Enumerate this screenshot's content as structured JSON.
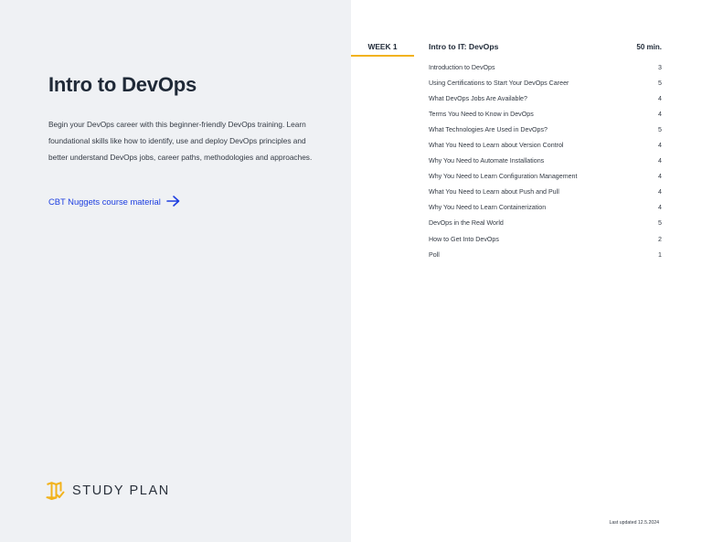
{
  "course": {
    "title": "Intro to DevOps",
    "description": "Begin your DevOps career with this beginner-friendly DevOps training. Learn foundational skills like how to identify, use and deploy DevOps principles and better understand DevOps jobs, career paths, methodologies and approaches.",
    "link_label": "CBT Nuggets course material"
  },
  "brand": {
    "label": "STUDY PLAN",
    "icon": "map-check-icon",
    "accent": "#f2b21b",
    "link_color": "#1d3ee0",
    "left_panel_bg": "#eff1f4"
  },
  "week": {
    "label": "WEEK 1",
    "title": "Intro to IT: DevOps",
    "duration": "50 min.",
    "lessons": [
      {
        "name": "Introduction to DevOps",
        "count": "3"
      },
      {
        "name": "Using Certifications to Start Your DevOps Career",
        "count": "5"
      },
      {
        "name": "What DevOps Jobs Are Available?",
        "count": "4"
      },
      {
        "name": "Terms You Need to Know in DevOps",
        "count": "4"
      },
      {
        "name": "What Technologies Are Used in DevOps?",
        "count": "5"
      },
      {
        "name": "What You Need to Learn about Version Control",
        "count": "4"
      },
      {
        "name": "Why You Need to Automate Installations",
        "count": "4"
      },
      {
        "name": "Why You Need to Learn Configuration Management",
        "count": "4"
      },
      {
        "name": "What You Need to Learn about Push and Pull",
        "count": "4"
      },
      {
        "name": "Why You Need to Learn Containerization",
        "count": "4"
      },
      {
        "name": "DevOps in the Real World",
        "count": "5"
      },
      {
        "name": "How to Get Into DevOps",
        "count": "2"
      },
      {
        "name": "Poll",
        "count": "1"
      }
    ]
  },
  "footer": {
    "last_updated": "Last updated 12.5.2024"
  }
}
